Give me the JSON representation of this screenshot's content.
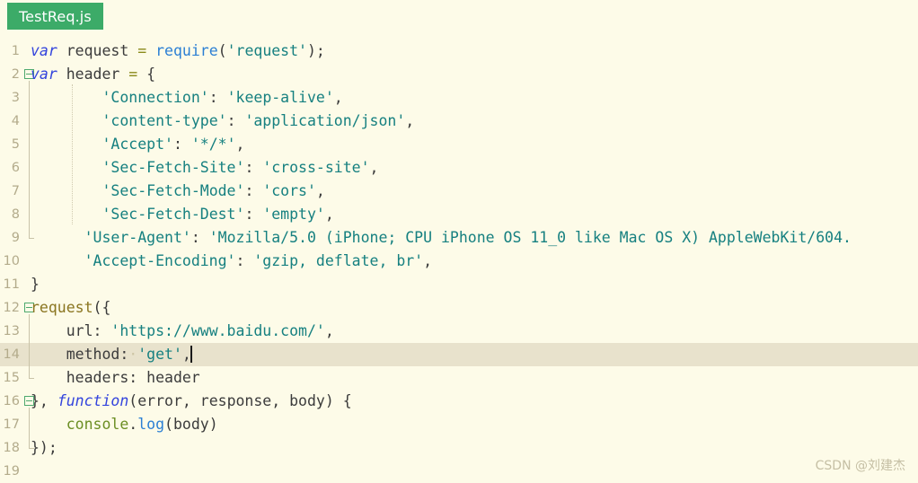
{
  "window": {
    "title": "TestReq.js",
    "type": "code-editor"
  },
  "tab": {
    "label": "TestReq.js",
    "active": true,
    "background_color": "#3cab68",
    "text_color": "#ffffff"
  },
  "editor": {
    "background_color": "#fdfbe8",
    "active_line_color": "#e8e2cc",
    "gutter_text_color": "#b3ab8b",
    "language": "javascript",
    "active_line": 14,
    "caret_line": 14,
    "caret_column": 20,
    "total_visible_lines": 19,
    "line_numbers": [
      "1",
      "2",
      "3",
      "4",
      "5",
      "6",
      "7",
      "8",
      "9",
      "10",
      "11",
      "12",
      "13",
      "14",
      "15",
      "16",
      "17",
      "18",
      "19"
    ],
    "fold_marker_lines": [
      2,
      12,
      16
    ],
    "lines": [
      {
        "n": "1",
        "text": "var request = require('request');",
        "tokens": [
          {
            "t": "var",
            "c": "t-kw"
          },
          {
            "t": " request ",
            "c": "t-plain"
          },
          {
            "t": "=",
            "c": "t-op"
          },
          {
            "t": " ",
            "c": "t-plain"
          },
          {
            "t": "require",
            "c": "t-fn"
          },
          {
            "t": "(",
            "c": "t-plain"
          },
          {
            "t": "'request'",
            "c": "t-str"
          },
          {
            "t": ");",
            "c": "t-plain"
          }
        ]
      },
      {
        "n": "2",
        "text": "var header = {",
        "tokens": [
          {
            "t": "var",
            "c": "t-kw"
          },
          {
            "t": " header ",
            "c": "t-plain"
          },
          {
            "t": "=",
            "c": "t-op"
          },
          {
            "t": " {",
            "c": "t-plain"
          }
        ]
      },
      {
        "n": "3",
        "text": "        'Connection': 'keep-alive',",
        "tokens": [
          {
            "t": "        ",
            "c": "t-plain"
          },
          {
            "t": "'Connection'",
            "c": "t-str"
          },
          {
            "t": ": ",
            "c": "t-plain"
          },
          {
            "t": "'keep-alive'",
            "c": "t-str"
          },
          {
            "t": ",",
            "c": "t-plain"
          }
        ]
      },
      {
        "n": "4",
        "text": "        'content-type': 'application/json',",
        "tokens": [
          {
            "t": "        ",
            "c": "t-plain"
          },
          {
            "t": "'content-type'",
            "c": "t-str"
          },
          {
            "t": ": ",
            "c": "t-plain"
          },
          {
            "t": "'application/json'",
            "c": "t-str"
          },
          {
            "t": ",",
            "c": "t-plain"
          }
        ]
      },
      {
        "n": "5",
        "text": "        'Accept': '*/*',",
        "tokens": [
          {
            "t": "        ",
            "c": "t-plain"
          },
          {
            "t": "'Accept'",
            "c": "t-str"
          },
          {
            "t": ": ",
            "c": "t-plain"
          },
          {
            "t": "'*/*'",
            "c": "t-str"
          },
          {
            "t": ",",
            "c": "t-plain"
          }
        ]
      },
      {
        "n": "6",
        "text": "        'Sec-Fetch-Site': 'cross-site',",
        "tokens": [
          {
            "t": "        ",
            "c": "t-plain"
          },
          {
            "t": "'Sec-Fetch-Site'",
            "c": "t-str"
          },
          {
            "t": ": ",
            "c": "t-plain"
          },
          {
            "t": "'cross-site'",
            "c": "t-str"
          },
          {
            "t": ",",
            "c": "t-plain"
          }
        ]
      },
      {
        "n": "7",
        "text": "        'Sec-Fetch-Mode': 'cors',",
        "tokens": [
          {
            "t": "        ",
            "c": "t-plain"
          },
          {
            "t": "'Sec-Fetch-Mode'",
            "c": "t-str"
          },
          {
            "t": ": ",
            "c": "t-plain"
          },
          {
            "t": "'cors'",
            "c": "t-str"
          },
          {
            "t": ",",
            "c": "t-plain"
          }
        ]
      },
      {
        "n": "8",
        "text": "        'Sec-Fetch-Dest': 'empty',",
        "tokens": [
          {
            "t": "        ",
            "c": "t-plain"
          },
          {
            "t": "'Sec-Fetch-Dest'",
            "c": "t-str"
          },
          {
            "t": ": ",
            "c": "t-plain"
          },
          {
            "t": "'empty'",
            "c": "t-str"
          },
          {
            "t": ",",
            "c": "t-plain"
          }
        ]
      },
      {
        "n": "9",
        "text": "      'User-Agent': 'Mozilla/5.0 (iPhone; CPU iPhone OS 11_0 like Mac OS X) AppleWebKit/604.",
        "tokens": [
          {
            "t": "      ",
            "c": "t-plain"
          },
          {
            "t": "'User-Agent'",
            "c": "t-str"
          },
          {
            "t": ": ",
            "c": "t-plain"
          },
          {
            "t": "'Mozilla/5.0 (iPhone; CPU iPhone OS 11_0 like Mac OS X) AppleWebKit/604.",
            "c": "t-str"
          }
        ]
      },
      {
        "n": "10",
        "text": "      'Accept-Encoding': 'gzip, deflate, br',",
        "tokens": [
          {
            "t": "      ",
            "c": "t-plain"
          },
          {
            "t": "'Accept-Encoding'",
            "c": "t-str"
          },
          {
            "t": ": ",
            "c": "t-plain"
          },
          {
            "t": "'gzip, deflate, br'",
            "c": "t-str"
          },
          {
            "t": ",",
            "c": "t-plain"
          }
        ]
      },
      {
        "n": "11",
        "text": "}",
        "tokens": [
          {
            "t": "}",
            "c": "t-plain"
          }
        ]
      },
      {
        "n": "12",
        "text": "request({",
        "tokens": [
          {
            "t": "request",
            "c": "t-call"
          },
          {
            "t": "({",
            "c": "t-plain"
          }
        ]
      },
      {
        "n": "13",
        "text": "    url: 'https://www.baidu.com/',",
        "tokens": [
          {
            "t": "    ",
            "c": "t-plain"
          },
          {
            "t": "url: ",
            "c": "t-plain"
          },
          {
            "t": "'https://www.baidu.com/'",
            "c": "t-str"
          },
          {
            "t": ",",
            "c": "t-plain"
          }
        ]
      },
      {
        "n": "14",
        "text": "    method: 'get',",
        "tokens": [
          {
            "t": "    ",
            "c": "t-plain"
          },
          {
            "t": "method:",
            "c": "t-plain"
          },
          {
            "t": "·",
            "c": "t-ws"
          },
          {
            "t": "'get'",
            "c": "t-str"
          },
          {
            "t": ",",
            "c": "t-plain"
          }
        ]
      },
      {
        "n": "15",
        "text": "    headers: header",
        "tokens": [
          {
            "t": "    headers: header",
            "c": "t-plain"
          }
        ]
      },
      {
        "n": "16",
        "text": "}, function(error, response, body) {",
        "tokens": [
          {
            "t": "}, ",
            "c": "t-plain"
          },
          {
            "t": "function",
            "c": "t-kw"
          },
          {
            "t": "(error, response, body) {",
            "c": "t-plain"
          }
        ]
      },
      {
        "n": "17",
        "text": "    console.log(body)",
        "tokens": [
          {
            "t": "    ",
            "c": "t-plain"
          },
          {
            "t": "console",
            "c": "t-obj"
          },
          {
            "t": ".",
            "c": "t-plain"
          },
          {
            "t": "log",
            "c": "t-fn"
          },
          {
            "t": "(body)",
            "c": "t-plain"
          }
        ]
      },
      {
        "n": "18",
        "text": "});",
        "tokens": [
          {
            "t": "});",
            "c": "t-plain"
          }
        ]
      },
      {
        "n": "19",
        "text": "",
        "tokens": []
      }
    ]
  },
  "watermark": {
    "text": "CSDN @刘建杰"
  }
}
